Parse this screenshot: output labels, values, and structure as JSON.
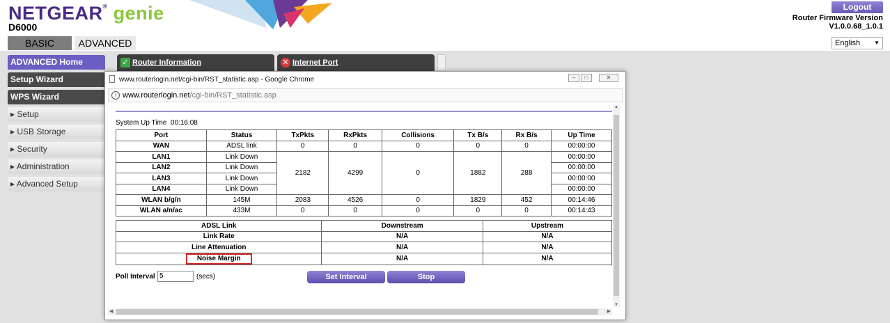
{
  "header": {
    "brand": "NETGEAR",
    "reg_mark": "®",
    "product": "genie",
    "model": "D6000",
    "logout_label": "Logout",
    "firmware_label": "Router Firmware Version",
    "firmware_version": "V1.0.0.68_1.0.1",
    "language": "English"
  },
  "tabs": [
    {
      "label": "BASIC"
    },
    {
      "label": "ADVANCED"
    }
  ],
  "sidebar": {
    "items": [
      {
        "label": "ADVANCED Home"
      },
      {
        "label": "Setup Wizard"
      },
      {
        "label": "WPS Wizard"
      },
      {
        "label": "▸ Setup"
      },
      {
        "label": "▸ USB Storage"
      },
      {
        "label": "▸ Security"
      },
      {
        "label": "▸ Administration"
      },
      {
        "label": "▸ Advanced Setup"
      }
    ]
  },
  "panels": {
    "router_info": "Router Information",
    "internet_port": "Internet Port"
  },
  "popup": {
    "window_title": "www.routerlogin.net/cgi-bin/RST_statistic.asp - Google Chrome",
    "url_host": "www.routerlogin.net",
    "url_path": "/cgi-bin/RST_statistic.asp",
    "uptime_label": "System Up Time",
    "uptime_value": "00:16:08",
    "stats_headers": [
      "Port",
      "Status",
      "TxPkts",
      "RxPkts",
      "Collisions",
      "Tx B/s",
      "Rx B/s",
      "Up Time"
    ],
    "wan": {
      "port": "WAN",
      "status": "ADSL link",
      "tx": "0",
      "rx": "0",
      "col": "0",
      "txb": "0",
      "rxb": "0",
      "up": "00:00:00"
    },
    "lan": [
      {
        "port": "LAN1",
        "status": "Link Down",
        "up": "00:00:00"
      },
      {
        "port": "LAN2",
        "status": "Link Down",
        "up": "00:00:00"
      },
      {
        "port": "LAN3",
        "status": "Link Down",
        "up": "00:00:00"
      },
      {
        "port": "LAN4",
        "status": "Link Down",
        "up": "00:00:00"
      }
    ],
    "lan_shared": {
      "tx": "2182",
      "rx": "4299",
      "col": "0",
      "txb": "1882",
      "rxb": "288"
    },
    "wlan_bgn": {
      "port": "WLAN b/g/n",
      "status": "145M",
      "tx": "2083",
      "rx": "4526",
      "col": "0",
      "txb": "1829",
      "rxb": "452",
      "up": "00:14:46"
    },
    "wlan_ac": {
      "port": "WLAN a/n/ac",
      "status": "433M",
      "tx": "0",
      "rx": "0",
      "col": "0",
      "txb": "0",
      "rxb": "0",
      "up": "00:14:43"
    },
    "adsl_headers": [
      "ADSL Link",
      "Downstream",
      "Upstream"
    ],
    "adsl_rows": [
      {
        "label": "Link Rate",
        "down": "N/A",
        "up": "N/A"
      },
      {
        "label": "Line Attenuation",
        "down": "N/A",
        "up": "N/A"
      },
      {
        "label": "Noise Margin",
        "down": "N/A",
        "up": "N/A"
      }
    ],
    "poll_label": "Poll Interval :",
    "poll_value": "5",
    "poll_unit": "(secs)",
    "set_interval_label": "Set Interval",
    "stop_label": "Stop"
  },
  "colors": {
    "brand_purple": "#4a2b86",
    "genie_green": "#8cc63f",
    "button_purple": "#6a5bb5",
    "highlight_red": "#d42a2a"
  }
}
